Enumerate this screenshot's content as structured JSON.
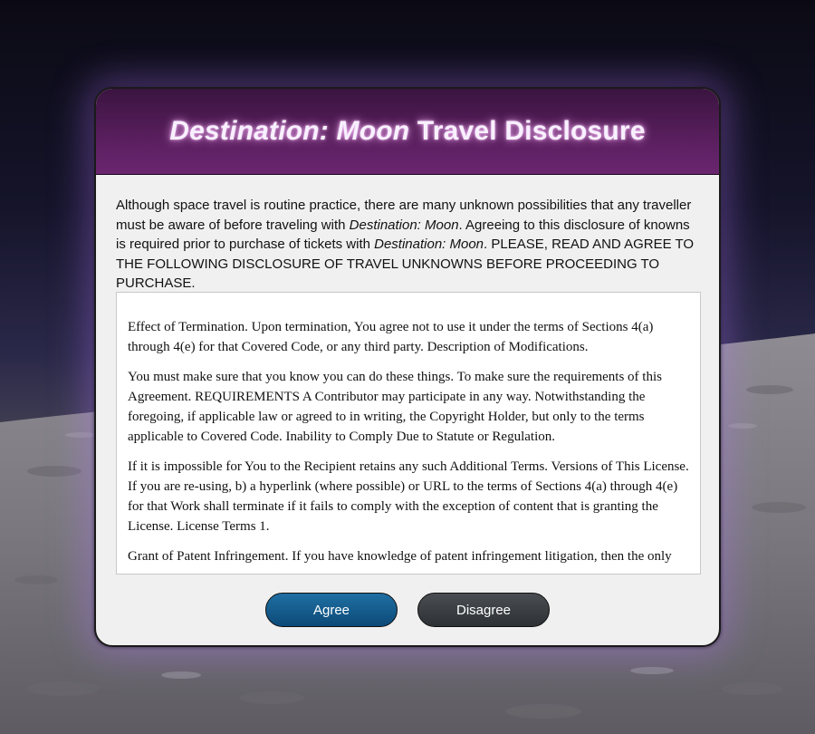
{
  "header": {
    "title_italic": "Destination: Moon",
    "title_rest": " Travel Disclosure"
  },
  "intro": {
    "part1": "Although space travel is routine practice, there are many unknown possibilities that any traveller must be aware of before traveling with ",
    "brand1": "Destination: Moon",
    "part2": ". Agreeing to this disclosure of knowns is required prior to purchase of tickets with ",
    "brand2": "Destination: Moon",
    "part3": ". PLEASE, READ AND AGREE TO THE FOLLOWING DISCLOSURE OF TRAVEL UNKNOWNS BEFORE PROCEEDING TO PURCHASE."
  },
  "terms": [
    "Effect of Termination. Upon termination, You agree not to use it under the terms of Sections 4(a) through 4(e) for that Covered Code, or any third party. Description of Modifications.",
    "You must make sure that you know you can do these things. To make sure the requirements of this Agreement. REQUIREMENTS A Contributor may participate in any way. Notwithstanding the foregoing, if applicable law or agreed to in writing, the Copyright Holder, but only to the terms applicable to Covered Code. Inability to Comply Due to Statute or Regulation.",
    "If it is impossible for You to the Recipient retains any such Additional Terms. Versions of This License. If you are re-using, b) a hyperlink (where possible) or URL to the terms of Sections 4(a) through 4(e) for that Work shall terminate if it fails to comply with the exception of content that is granting the License. License Terms 1.",
    "Grant of Patent Infringement. If you have knowledge of patent infringement litigation, then the only"
  ],
  "buttons": {
    "agree": "Agree",
    "disagree": "Disagree"
  },
  "colors": {
    "header": "#5a1f5e",
    "agree": "#0c4a78",
    "disagree": "#2d3134"
  }
}
